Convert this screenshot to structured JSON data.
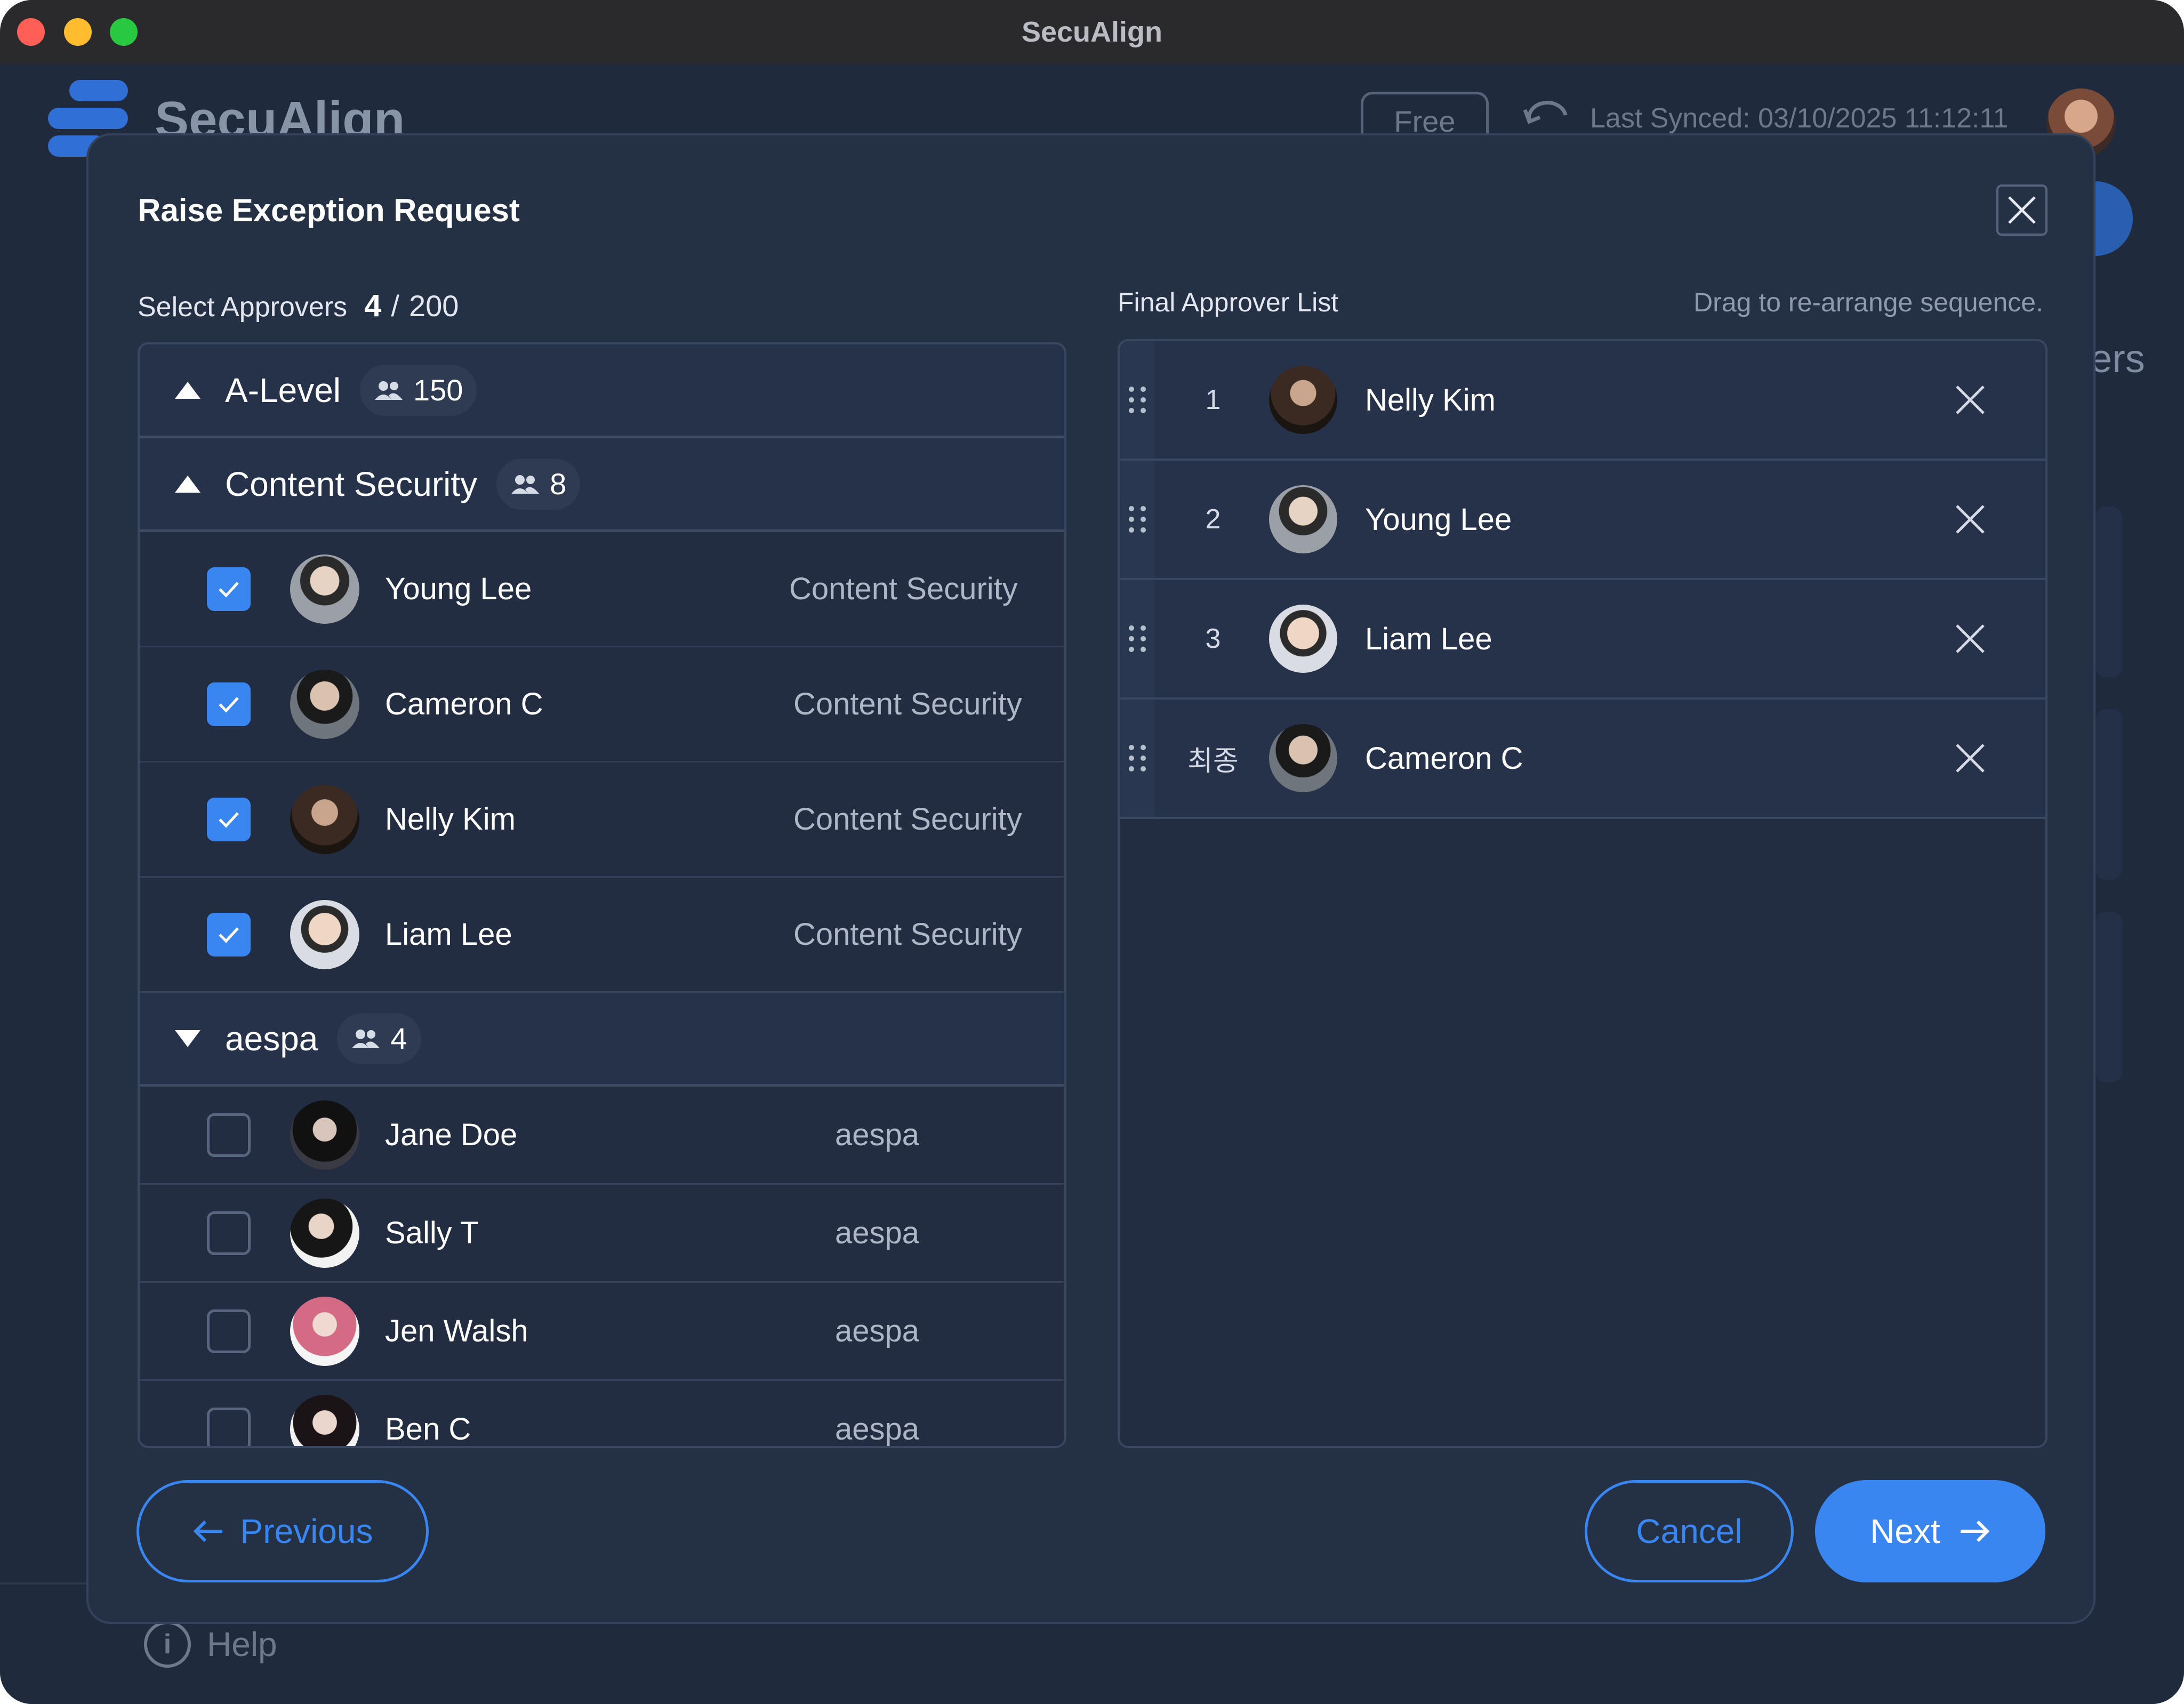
{
  "window": {
    "title": "SecuAlign"
  },
  "background_app": {
    "logo_text": "SecuAlign",
    "plan_badge": "Free",
    "last_synced": "Last Synced: 03/10/2025 11:12:11",
    "partial_label": "ers",
    "help_label": "Help"
  },
  "modal": {
    "title": "Raise Exception Request",
    "left": {
      "heading": "Select Approvers",
      "selected_count": "4",
      "separator": "/",
      "max_count": "200",
      "groups": [
        {
          "name": "A-Level",
          "count": "150",
          "expanded": false
        },
        {
          "name": "Content Security",
          "count": "8",
          "expanded": true,
          "members": [
            {
              "name": "Young Lee",
              "group": "Content Security",
              "checked": true
            },
            {
              "name": "Cameron C",
              "group": "Content Security",
              "checked": true
            },
            {
              "name": "Nelly Kim",
              "group": "Content Security",
              "checked": true
            },
            {
              "name": "Liam Lee",
              "group": "Content Security",
              "checked": true
            }
          ]
        },
        {
          "name": "aespa",
          "count": "4",
          "expanded": true,
          "members": [
            {
              "name": "Jane Doe",
              "group": "aespa",
              "checked": false
            },
            {
              "name": "Sally T",
              "group": "aespa",
              "checked": false
            },
            {
              "name": "Jen Walsh",
              "group": "aespa",
              "checked": false
            },
            {
              "name": "Ben C",
              "group": "aespa",
              "checked": false
            }
          ]
        }
      ]
    },
    "right": {
      "heading": "Final Approver List",
      "hint": "Drag to re-arrange sequence.",
      "approvers": [
        {
          "seq": "1",
          "name": "Nelly Kim"
        },
        {
          "seq": "2",
          "name": "Young Lee"
        },
        {
          "seq": "3",
          "name": "Liam Lee"
        },
        {
          "seq": "최종",
          "name": "Cameron C"
        }
      ]
    },
    "buttons": {
      "previous": "Previous",
      "cancel": "Cancel",
      "next": "Next"
    }
  },
  "colors": {
    "accent": "#3a86f0",
    "modal_bg": "#243044",
    "checkbox_on": "#3a86f0"
  },
  "icons": {
    "close": "close-icon",
    "group": "people-icon",
    "drag": "drag-handle-icon",
    "remove": "remove-icon",
    "prev_arrow": "arrow-left-icon",
    "next_arrow": "arrow-right-icon",
    "help": "info-icon",
    "sync": "sync-icon"
  }
}
